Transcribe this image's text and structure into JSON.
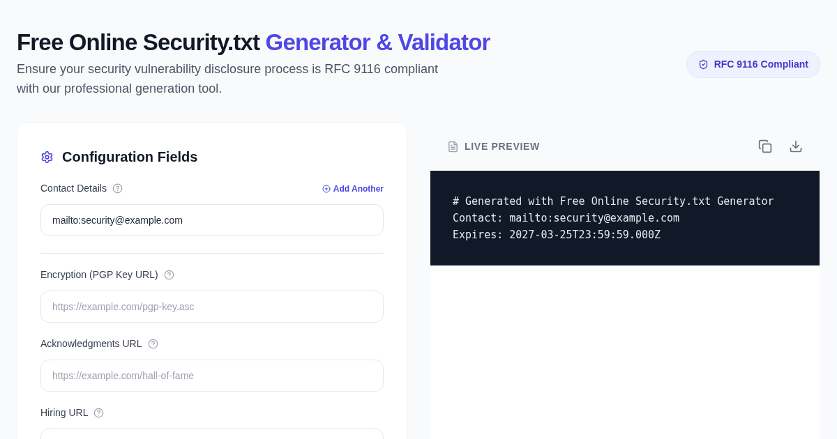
{
  "header": {
    "title": "Free Online Security.txt",
    "title_highlight": "Generator & Validator",
    "subtitle": "Ensure your security vulnerability disclosure process is RFC 9116 compliant with our professional generation tool.",
    "badge": "RFC 9116 Compliant"
  },
  "config": {
    "title": "Configuration Fields",
    "add_link": "Add Another",
    "fields": [
      {
        "label": "Contact Details",
        "value": "mailto:security@example.com"
      },
      {
        "label": "Encryption (PGP Key URL)",
        "placeholder": "https://example.com/pgp-key.asc"
      },
      {
        "label": "Acknowledgments URL",
        "placeholder": "https://example.com/hall-of-fame"
      },
      {
        "label": "Hiring URL"
      }
    ]
  },
  "preview": {
    "title": "LIVE PREVIEW",
    "lines": [
      "# Generated with Free Online Security.txt Generator",
      "Contact: mailto:security@example.com",
      "Expires: 2027-03-25T23:59:59.000Z"
    ]
  }
}
